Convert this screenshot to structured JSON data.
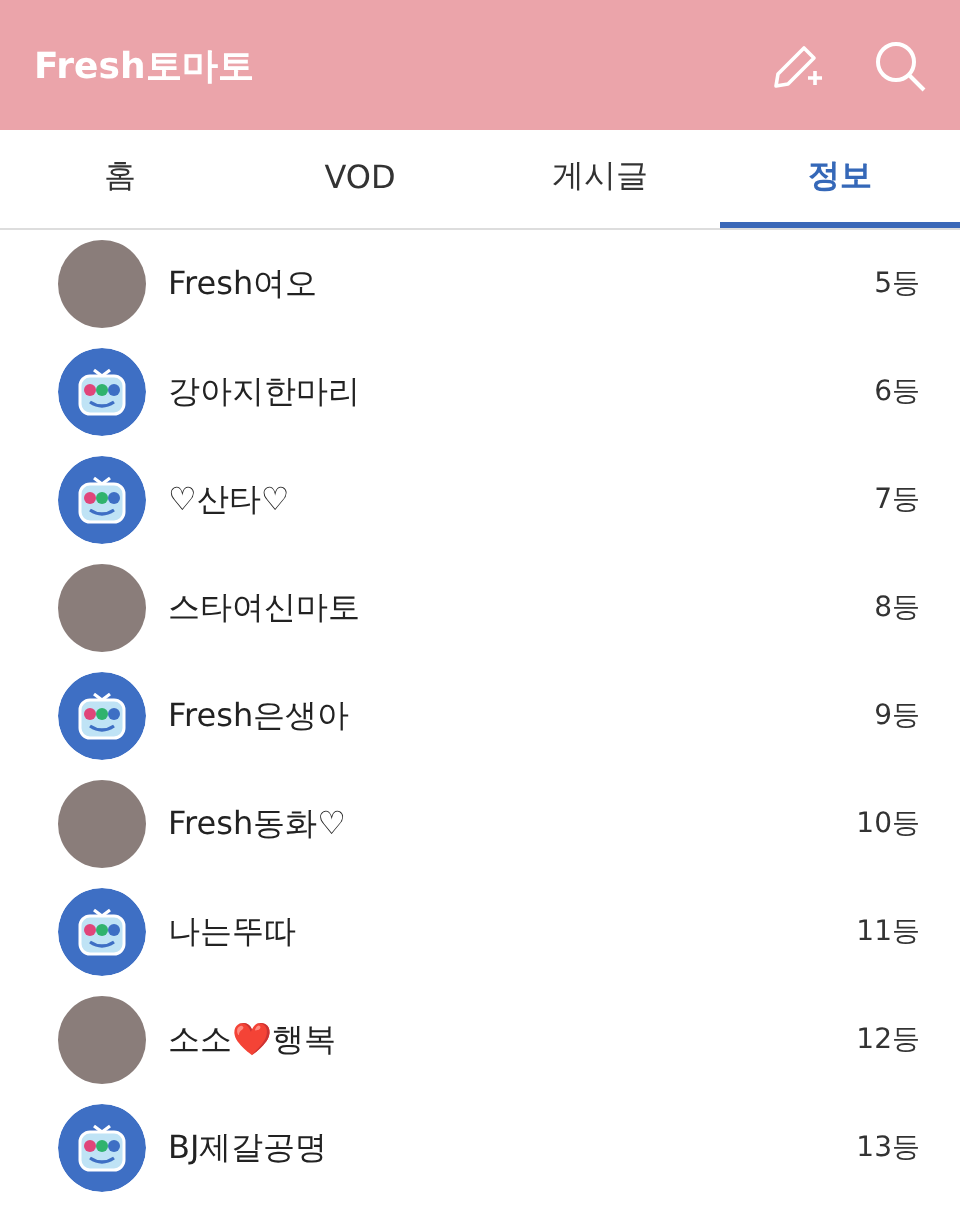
{
  "header": {
    "title": "Fresh토마토"
  },
  "tabs": [
    {
      "label": "홈",
      "selected": false
    },
    {
      "label": "VOD",
      "selected": false
    },
    {
      "label": "게시글",
      "selected": false
    },
    {
      "label": "정보",
      "selected": true
    }
  ],
  "ranking": [
    {
      "kind": "photo",
      "name": "Fresh여오",
      "rank": "5등"
    },
    {
      "kind": "default",
      "name": "강아지한마리",
      "rank": "6등"
    },
    {
      "kind": "default",
      "name": "♡산타♡",
      "rank": "7등"
    },
    {
      "kind": "photo",
      "name": "스타여신마토",
      "rank": "8등"
    },
    {
      "kind": "default",
      "name": "Fresh은생아",
      "rank": "9등"
    },
    {
      "kind": "photo",
      "name": "Fresh동화♡",
      "rank": "10등"
    },
    {
      "kind": "default",
      "name": "나는뚜따",
      "rank": "11등"
    },
    {
      "kind": "photo",
      "name": "소소❤️행복",
      "rank": "12등"
    },
    {
      "kind": "default",
      "name": "BJ제갈공명",
      "rank": "13등"
    }
  ]
}
